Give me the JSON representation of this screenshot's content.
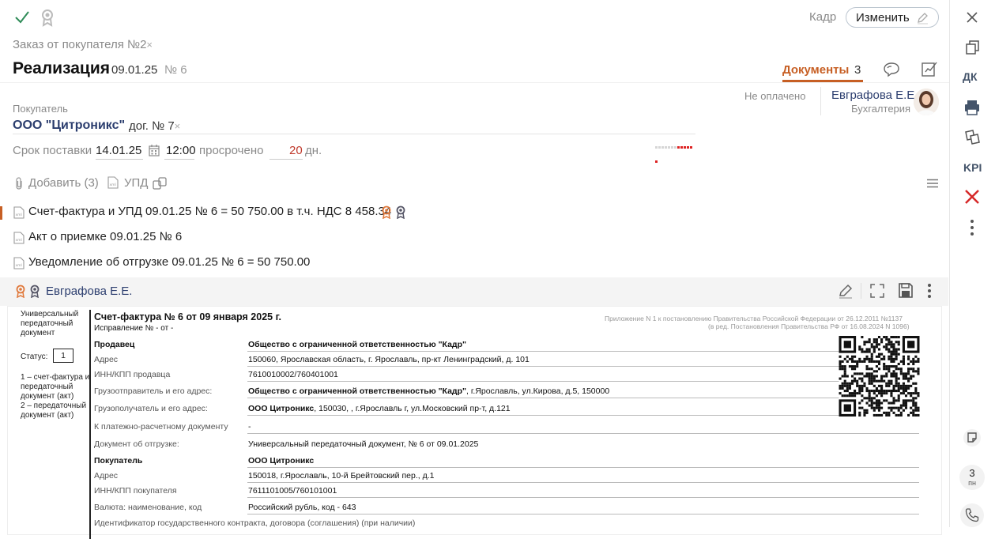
{
  "header": {
    "kadr_label": "Кадр",
    "change_label": "Изменить",
    "breadcrumb": "Заказ от покупателя №2",
    "breadcrumb_close": "×",
    "title": "Реализация",
    "date": "09.01.25",
    "number": "№ 6",
    "docs_tab": "Документы",
    "docs_count": "3"
  },
  "buyer": {
    "label": "Покупатель",
    "name": "ООО \"Цитроникс\"",
    "contract": "дог. № 7",
    "contract_close": "×",
    "payment_status": "Не оплачено",
    "responsible_name": "Евграфова Е.Е.",
    "responsible_dept": "Бухгалтерия"
  },
  "delivery": {
    "label": "Срок поставки",
    "date": "14.01.25",
    "time": "12:00",
    "overdue_label": "просрочено",
    "overdue_days": "20",
    "days_unit": "дн."
  },
  "toolbar": {
    "add_label": "Добавить (3)",
    "upd_label": "УПД"
  },
  "documents": [
    {
      "title": "Счет-фактура и УПД 09.01.25 № 6 = 50 750.00 в т.ч. НДС 8 458.34",
      "selected": true
    },
    {
      "title": "Акт о приемке 09.01.25 № 6",
      "selected": false
    },
    {
      "title": "Уведомление об отгрузке 09.01.25 № 6 = 50 750.00",
      "selected": false
    }
  ],
  "signature": {
    "signer": "Евграфова Е.Е."
  },
  "preview": {
    "left_title": "Универсальный передаточный документ",
    "status_label": "Статус:",
    "status_value": "1",
    "status_note1": "1 – счет-фактура и передаточный документ (акт)",
    "status_note2": "2 – передаточный документ (акт)",
    "invoice_title": "Счет-фактура № 6 от 09 января 2025 г.",
    "correction": "Исправление № - от -",
    "appendix1": "Приложение N 1 к постановлению Правительства Российской Федерации от 26.12.2011 №1137",
    "appendix2": "(в ред. Постановления Правительства РФ от 16.08.2024 N 1096)",
    "rows": [
      {
        "label": "Продавец",
        "value": "Общество с ограниченной ответственностью \"Кадр\"",
        "bold_label": true,
        "bold_value": true,
        "suffix": ""
      },
      {
        "label": "Адрес",
        "value": "150060, Ярославская область, г. Ярославль, пр-кт Ленинградский, д. 101",
        "bold_label": false,
        "bold_value": false,
        "suffix": ""
      },
      {
        "label": "ИНН/КПП продавца",
        "value": "7610010002/760401001",
        "bold_label": false,
        "bold_value": false,
        "suffix": ""
      },
      {
        "label": "Грузоотправитель и его адрес:",
        "value": "Общество с ограниченной ответственностью \"Кадр\"",
        "bold_label": false,
        "bold_value": true,
        "suffix": ", г.Ярославль, ул.Кирова, д.5, 150000"
      },
      {
        "label": "Грузополучатель и его адрес:",
        "value": "ООО Цитроникс",
        "bold_label": false,
        "bold_value": true,
        "suffix": ", 150030, , г.Ярославль г, ул.Московский пр-т, д.121"
      },
      {
        "label": "К платежно-расчетному документу",
        "value": "-",
        "bold_label": false,
        "bold_value": false,
        "suffix": ""
      },
      {
        "label": "Документ об отгрузке:",
        "value": "Универсальный передаточный документ, № 6 от 09.01.2025",
        "bold_label": false,
        "bold_value": false,
        "suffix": ""
      },
      {
        "label": "Покупатель",
        "value": "ООО Цитроникс",
        "bold_label": true,
        "bold_value": true,
        "suffix": ""
      },
      {
        "label": "Адрес",
        "value": "150018, г.Ярославль, 10-й Брейтовский пер., д.1",
        "bold_label": false,
        "bold_value": false,
        "suffix": ""
      },
      {
        "label": "ИНН/КПП покупателя",
        "value": "7611101005/760101001",
        "bold_label": false,
        "bold_value": false,
        "suffix": ""
      },
      {
        "label": "Валюта: наименование, код",
        "value": "Российский рубль, код - 643",
        "bold_label": false,
        "bold_value": false,
        "suffix": ""
      },
      {
        "label": "Идентификатор государственного контракта, договора (соглашения) (при наличии)",
        "value": "",
        "bold_label": false,
        "bold_value": false,
        "suffix": ""
      }
    ]
  },
  "rightbar": {
    "dk_label": "ДК",
    "kpi_label": "KPI",
    "day_num": "3",
    "day_name": "пн"
  },
  "colors": {
    "accent": "#c75f24",
    "link": "#2b3d6e",
    "overdue": "#c0392b",
    "check": "#2e8b57"
  }
}
